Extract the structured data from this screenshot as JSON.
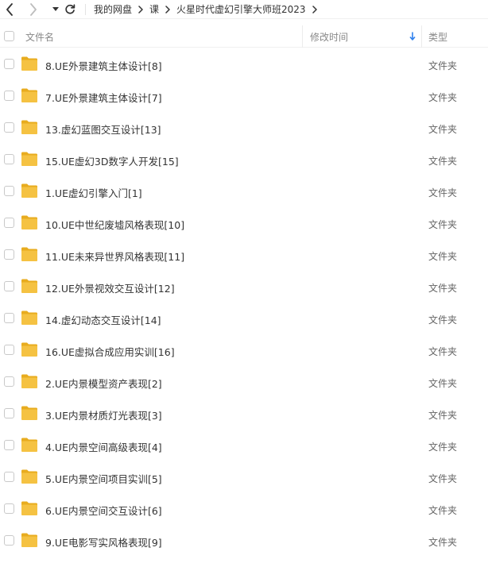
{
  "nav": {
    "breadcrumb": [
      {
        "label": "我的网盘"
      },
      {
        "label": "课"
      },
      {
        "label": "火星时代虚幻引擎大师班2023"
      }
    ]
  },
  "header": {
    "name_label": "文件名",
    "time_label": "修改时间",
    "type_label": "类型"
  },
  "colors": {
    "folder": "#f5c242",
    "folder_back": "#e8ac1f",
    "sort_arrow": "#2f80ed"
  },
  "files": [
    {
      "name": "8.UE外景建筑主体设计[8]",
      "type": "文件夹"
    },
    {
      "name": "7.UE外景建筑主体设计[7]",
      "type": "文件夹"
    },
    {
      "name": "13.虚幻蓝图交互设计[13]",
      "type": "文件夹"
    },
    {
      "name": "15.UE虚幻3D数字人开发[15]",
      "type": "文件夹"
    },
    {
      "name": "1.UE虚幻引擎入门[1]",
      "type": "文件夹"
    },
    {
      "name": "10.UE中世纪废墟风格表现[10]",
      "type": "文件夹"
    },
    {
      "name": "11.UE未来异世界风格表现[11]",
      "type": "文件夹"
    },
    {
      "name": "12.UE外景视效交互设计[12]",
      "type": "文件夹"
    },
    {
      "name": "14.虚幻动态交互设计[14]",
      "type": "文件夹"
    },
    {
      "name": "16.UE虚拟合成应用实训[16]",
      "type": "文件夹"
    },
    {
      "name": "2.UE内景模型资产表现[2]",
      "type": "文件夹"
    },
    {
      "name": "3.UE内景材质灯光表现[3]",
      "type": "文件夹"
    },
    {
      "name": "4.UE内景空间高级表现[4]",
      "type": "文件夹"
    },
    {
      "name": "5.UE内景空间项目实训[5]",
      "type": "文件夹"
    },
    {
      "name": "6.UE内景空间交互设计[6]",
      "type": "文件夹"
    },
    {
      "name": "9.UE电影写实风格表现[9]",
      "type": "文件夹"
    }
  ]
}
